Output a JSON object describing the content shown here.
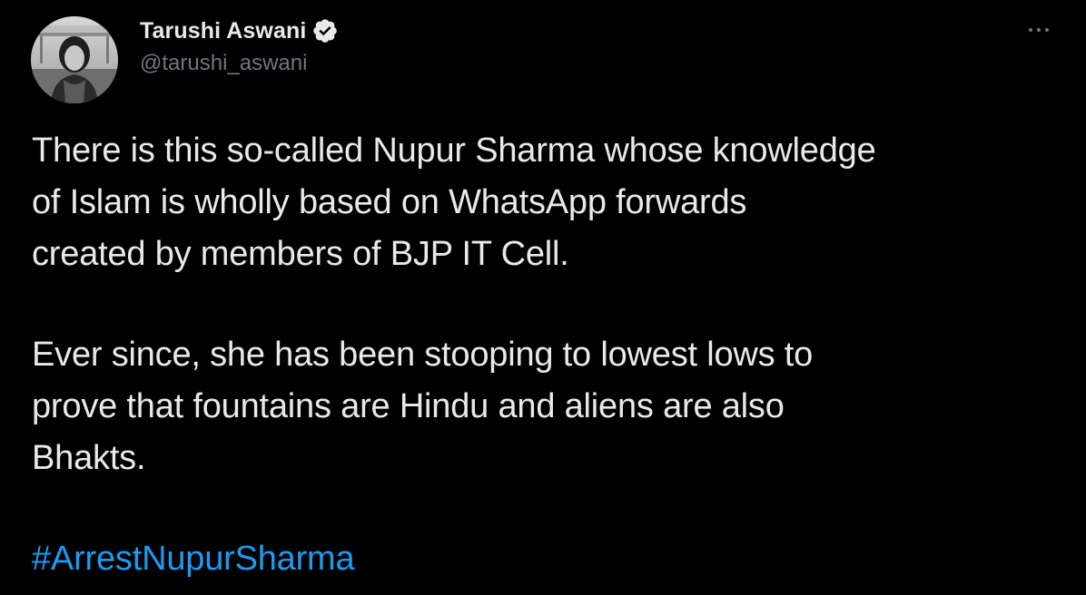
{
  "author": {
    "display_name": "Tarushi Aswani",
    "handle": "@tarushi_aswani",
    "verified": true
  },
  "tweet": {
    "paragraph_1": "There is this so-called Nupur Sharma whose knowledge\nof Islam is wholly based on WhatsApp forwards\ncreated by members of BJP IT Cell.",
    "paragraph_2": "Ever since, she has been stooping to lowest lows to\nprove that fountains are Hindu and aliens are also\nBhakts.",
    "hashtag": "#ArrestNupurSharma"
  },
  "icons": {
    "verified": "verified-badge-icon",
    "more": "more-options-icon"
  },
  "colors": {
    "background": "#000000",
    "text": "#e7e9ea",
    "secondary_text": "#71767b",
    "link": "#1d9bf0"
  }
}
